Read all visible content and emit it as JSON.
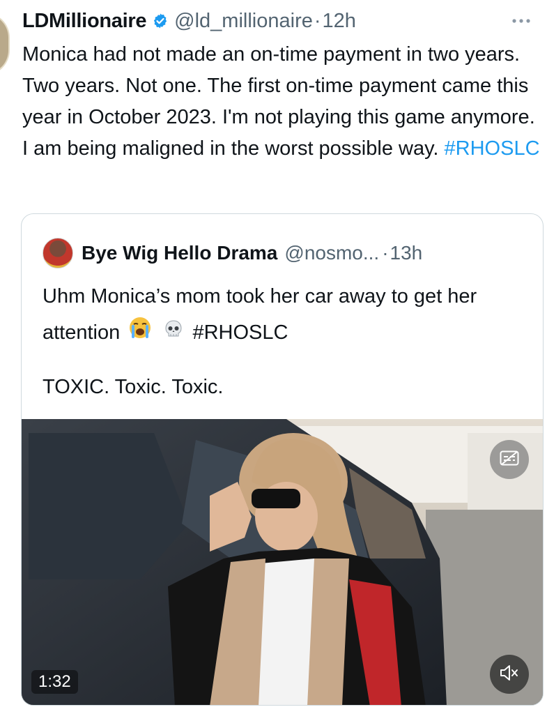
{
  "tweet": {
    "display_name": "LDMillionaire",
    "handle": "@ld_millionaire",
    "separator": "·",
    "time": "12h",
    "text_before": "Monica had not made an on-time payment in two years. Two years. Not one. The first on-time payment came this year in October 2023. I'm not playing this game anymore. I am being maligned in the worst possible way. ",
    "hashtag": "#RHOSLC",
    "icons": {
      "verified": "verified-badge-icon",
      "more": "more-options-icon"
    },
    "colors": {
      "link": "#1d9bf0",
      "verified": "#1d9bf0",
      "text": "#0f1419",
      "muted": "#536471"
    }
  },
  "quote": {
    "display_name": "Bye Wig Hello Drama",
    "handle": "@nosmo...",
    "separator": "·",
    "time": "13h",
    "text_part1": "Uhm Monica’s mom took her car away to get her attention",
    "hashtag": "#RHOSLC",
    "text_line3": "TOXIC. Toxic. Toxic.",
    "emojis": [
      "loudly-crying-face-emoji",
      "skull-emoji"
    ],
    "video": {
      "duration": "1:32",
      "icons": {
        "captions": "captions-icon",
        "mute": "muted-speaker-icon"
      }
    }
  }
}
